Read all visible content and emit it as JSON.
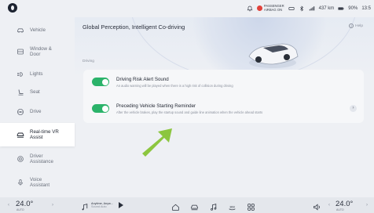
{
  "status": {
    "airbag_line1": "PASSENGER",
    "airbag_line2": "AIRBAG ON",
    "range": "437 km",
    "battery": "90%",
    "time": "13:5"
  },
  "sidebar": {
    "items": [
      {
        "label": "Vehicle",
        "icon": "car-icon"
      },
      {
        "label": "Window &\nDoor",
        "icon": "window-icon"
      },
      {
        "label": "Lights",
        "icon": "lights-icon"
      },
      {
        "label": "Seat",
        "icon": "seat-icon"
      },
      {
        "label": "Drive",
        "icon": "steering-wheel-icon"
      },
      {
        "label": "Real-time VR\nAssist",
        "icon": "vr-assist-icon",
        "active": true
      },
      {
        "label": "Driver\nAssistance",
        "icon": "driver-assistance-icon"
      },
      {
        "label": "Voice\nAssistant",
        "icon": "voice-icon"
      }
    ]
  },
  "main": {
    "title": "Global Perception, Intelligent Co-driving",
    "help": "Help",
    "section_label": "Driving",
    "settings": [
      {
        "title": "Driving Risk Alert Sound",
        "description": "An audio warning will be played when there is a high risk of collision during driving",
        "enabled": true
      },
      {
        "title": "Preceding Vehicle Starting Reminder",
        "description": "After the vehicle brakes, play the startup sound and guide line animation when the vehicle ahead starts",
        "enabled": true
      }
    ]
  },
  "bottom": {
    "temp_left": "24.0°",
    "temp_right": "24.0°",
    "temp_unit_left": "AUTO",
    "temp_unit_right": "AUTO",
    "media_title": "Anytime, Anyw...",
    "media_sub": "Sound Auto"
  },
  "colors": {
    "toggle_on": "#2bb36a",
    "arrow": "#8cc63f",
    "airbag_indicator": "#e0413b"
  }
}
